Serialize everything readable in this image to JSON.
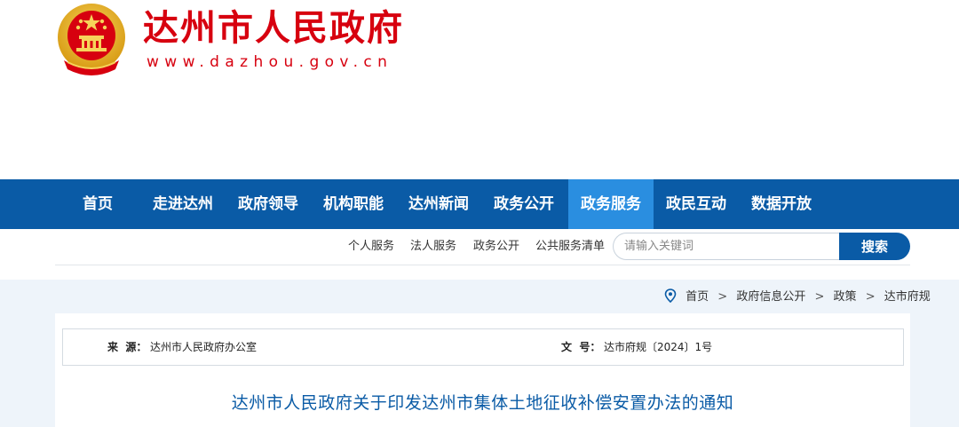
{
  "header": {
    "site_title": "达州市人民政府",
    "site_url": "www.dazhou.gov.cn",
    "emblem_icon": "national-emblem-icon"
  },
  "nav": {
    "items": [
      {
        "label": "首页"
      },
      {
        "label": "走进达州"
      },
      {
        "label": "政府领导"
      },
      {
        "label": "机构职能"
      },
      {
        "label": "达州新闻"
      },
      {
        "label": "政务公开"
      },
      {
        "label": "政务服务"
      },
      {
        "label": "政民互动"
      },
      {
        "label": "数据开放"
      }
    ],
    "active": "政务服务"
  },
  "subnav": {
    "links": [
      "个人服务",
      "法人服务",
      "政务公开",
      "公共服务清单"
    ],
    "search_placeholder": "请输入关键词",
    "search_button": "搜索"
  },
  "breadcrumb": {
    "icon": "location-pin-icon",
    "items": [
      "首页",
      "政府信息公开",
      "政策",
      "达市府规"
    ],
    "separator": ">"
  },
  "meta": {
    "source_label": "来  源：",
    "source_value": "达州市人民政府办公室",
    "doc_no_label": "文  号：",
    "doc_no_value": "达市府规〔2024〕1号"
  },
  "document": {
    "title": "达州市人民政府关于印发达州市集体土地征收补偿安置办法的通知"
  },
  "colors": {
    "brand_red": "#d7000f",
    "nav_blue": "#0a5ba6",
    "nav_active": "#2a8ee0",
    "content_bg": "#eef4fa"
  }
}
